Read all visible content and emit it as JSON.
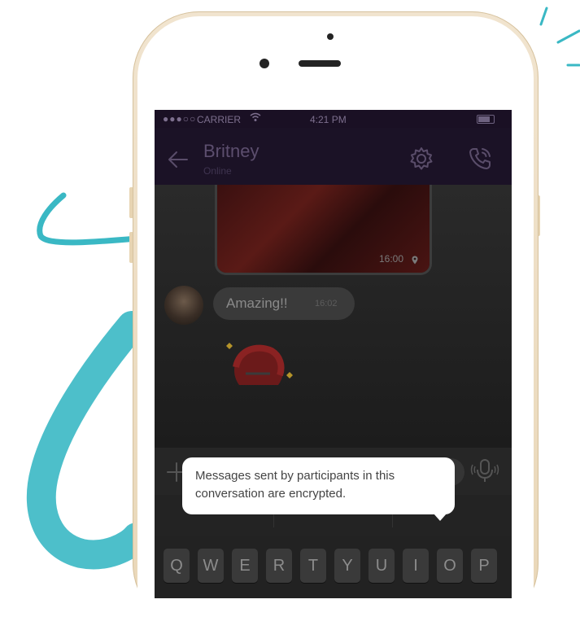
{
  "status_bar": {
    "signal": "●●●○○",
    "carrier": "CARRIER",
    "time": "4:21 PM"
  },
  "header": {
    "contact_name": "Britney",
    "contact_status": "Online"
  },
  "messages": {
    "photo_time": "16:00",
    "text_message": "Amazing!!",
    "text_time": "16:02"
  },
  "tooltip": {
    "text": "Messages sent by participants in this conversation are encrypted."
  },
  "composer": {
    "placeholder": ""
  },
  "keyboard": {
    "row1": [
      "Q",
      "W",
      "E",
      "R",
      "T",
      "Y",
      "U",
      "I",
      "O",
      "P"
    ]
  },
  "colors": {
    "header_bg": "#1b1226",
    "doodle": "#3ab8c4",
    "phone_gold": "#e9d7b8"
  }
}
